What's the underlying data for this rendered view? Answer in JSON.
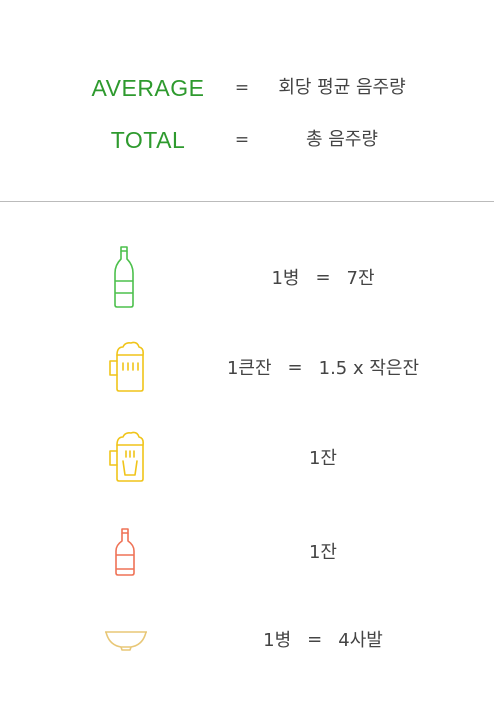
{
  "legend": {
    "average": {
      "term": "AVERAGE",
      "eq": "=",
      "definition": "회당 평균 음주량",
      "color": "#2e9a2e"
    },
    "total": {
      "term": "TOTAL",
      "eq": "=",
      "definition": "총 음주량",
      "color": "#2e9a2e"
    }
  },
  "rows": [
    {
      "icon": "soju-bottle-icon",
      "color": "#4cc04c",
      "left": "1병",
      "eq": "=",
      "right": "7잔"
    },
    {
      "icon": "beer-mug-icon",
      "color": "#f0c419",
      "left": "1큰잔",
      "eq": "=",
      "right": "1.5 x 작은잔"
    },
    {
      "icon": "beer-mug-glass-icon",
      "color": "#f0c419",
      "left": "1잔",
      "eq": "",
      "right": ""
    },
    {
      "icon": "wine-bottle-icon",
      "color": "#ef7256",
      "left": "1잔",
      "eq": "",
      "right": ""
    },
    {
      "icon": "makgeolli-bowl-icon",
      "color": "#e8c777",
      "left": "1병",
      "eq": "=",
      "right": "4사발"
    }
  ]
}
